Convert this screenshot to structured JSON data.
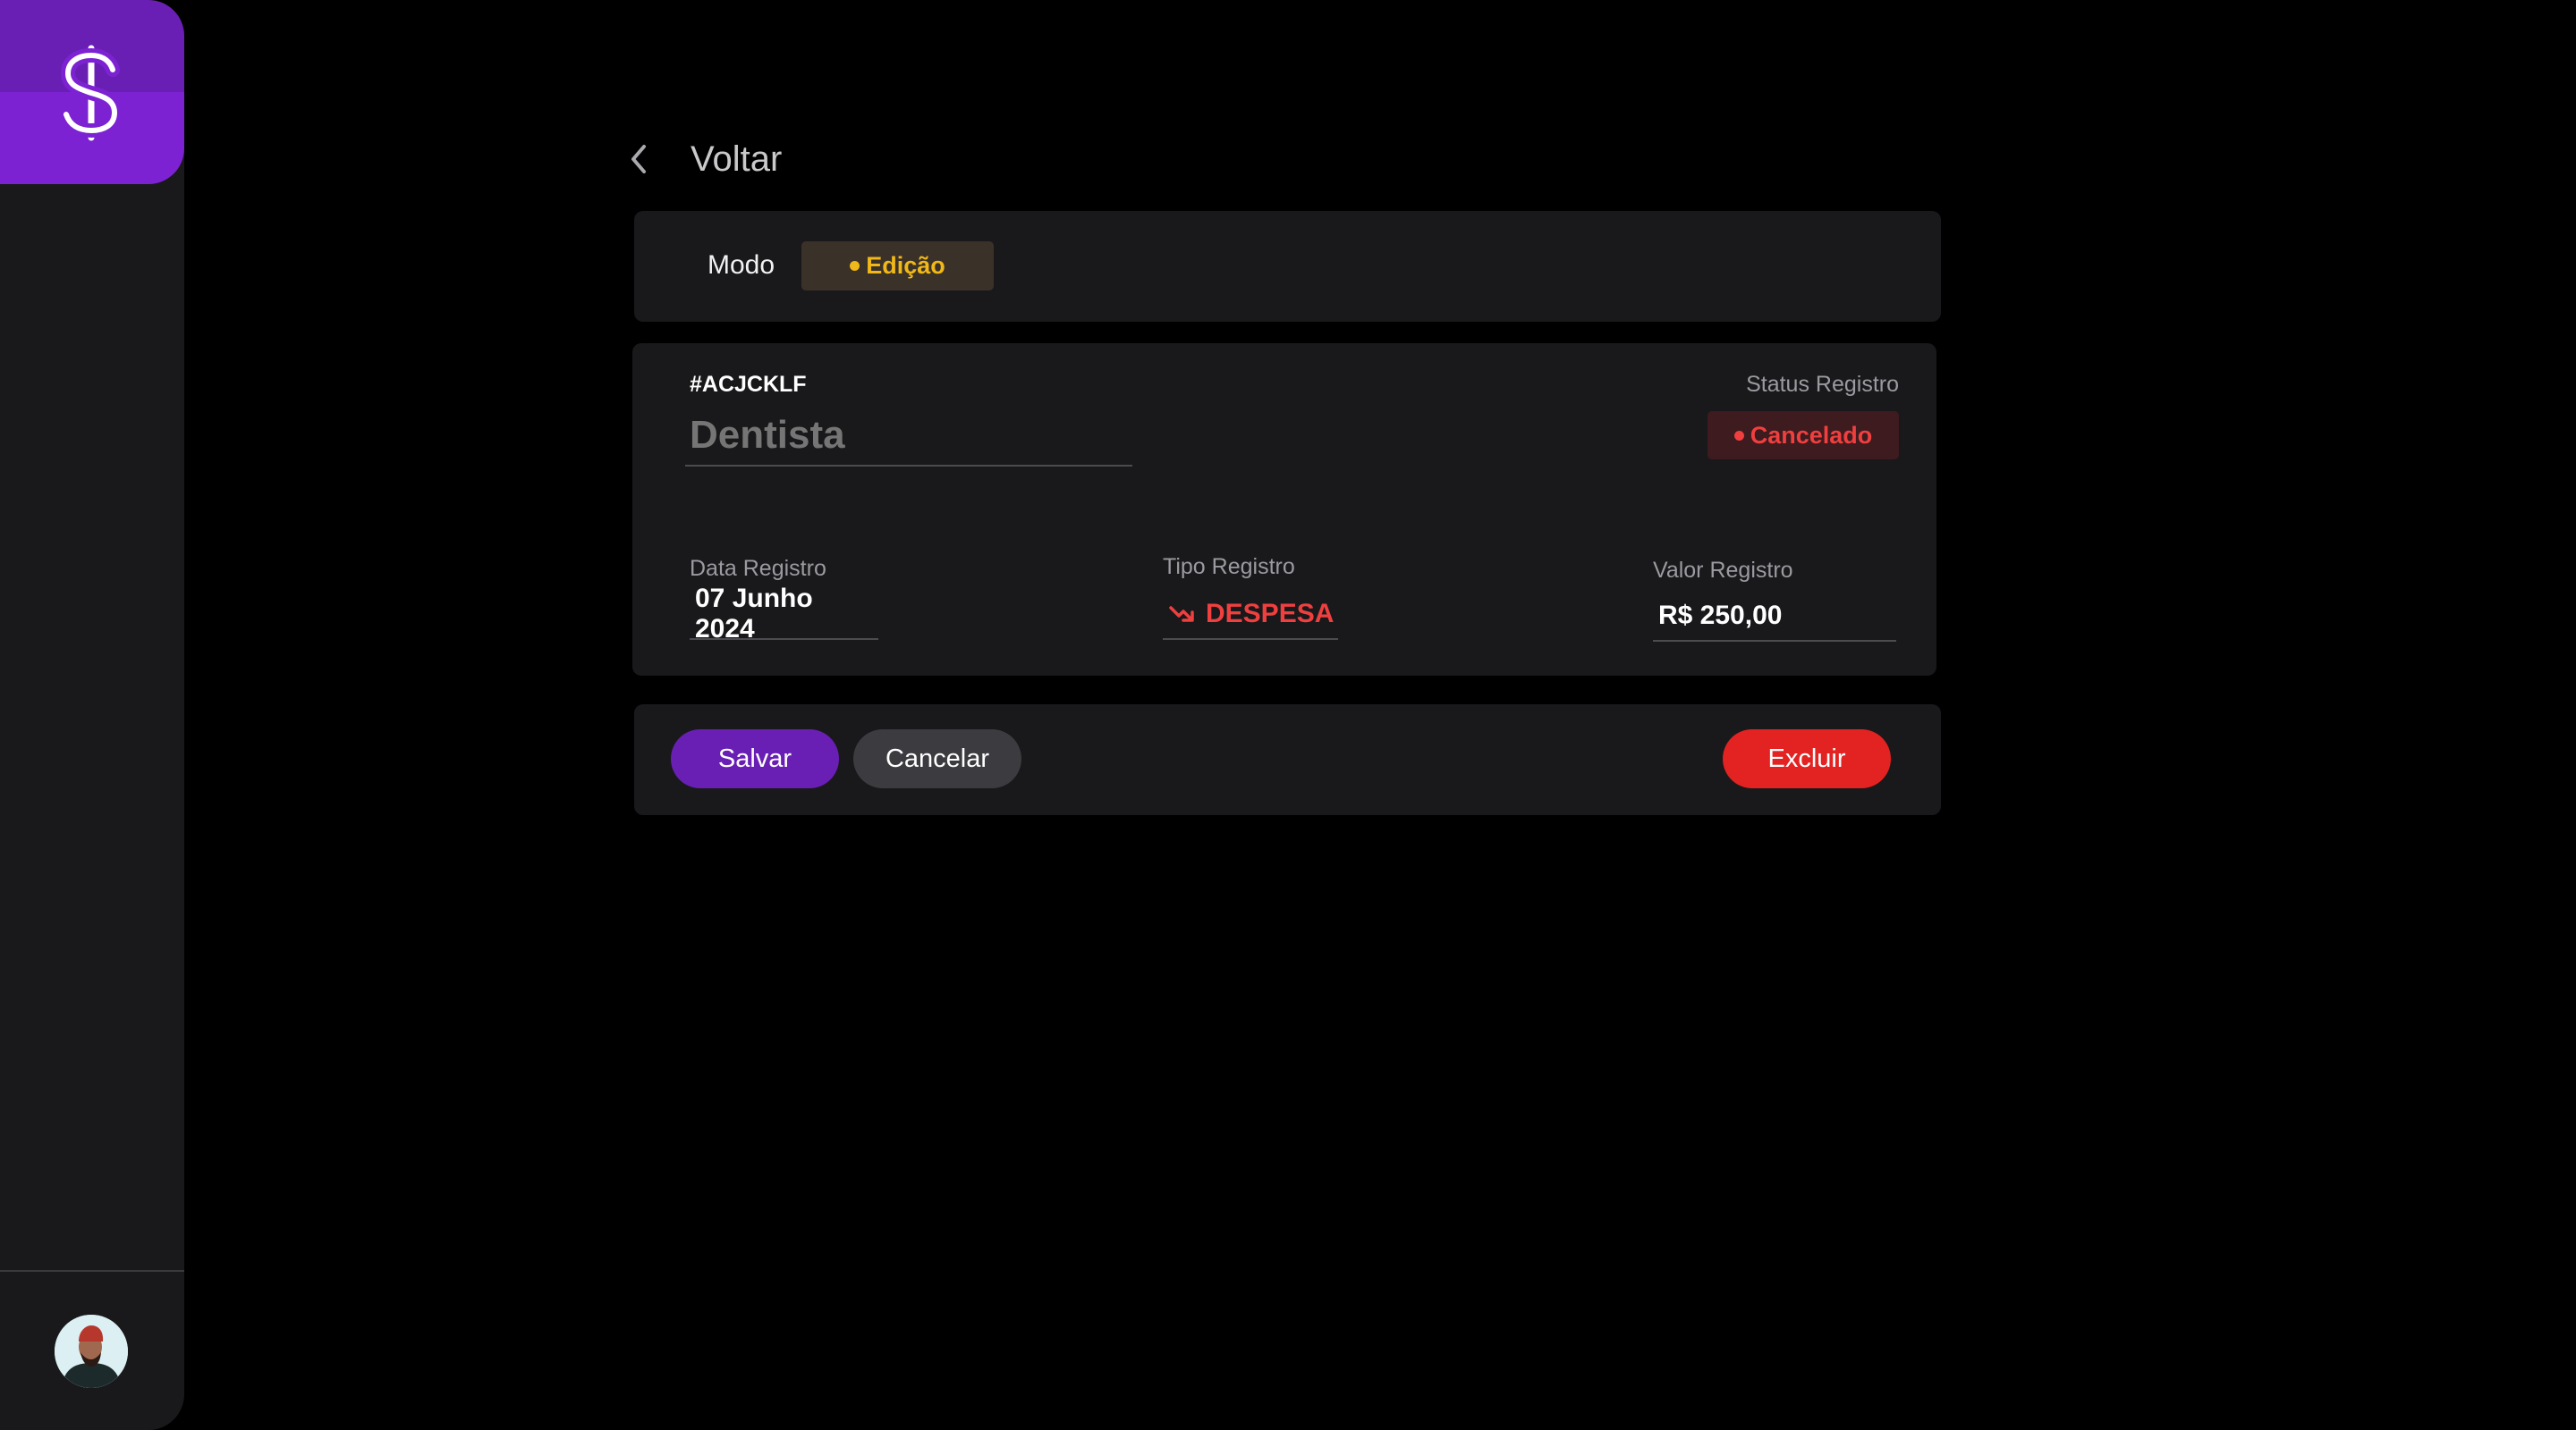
{
  "colors": {
    "background": "#000000",
    "surface": "#19191b",
    "brand": "#7c22d3",
    "warning": "#f0b818",
    "danger": "#ef3f3f"
  },
  "sidebar": {
    "logo_icon": "dollar-sign-icon",
    "avatar": "user-avatar"
  },
  "header": {
    "back_icon": "chevron-left-icon",
    "back_label": "Voltar"
  },
  "mode": {
    "label": "Modo",
    "badge": "Edição"
  },
  "record": {
    "code": "#ACJCKLF",
    "name_placeholder": "Dentista",
    "status_label": "Status Registro",
    "status_value": "Cancelado",
    "date_label": "Data Registro",
    "date_value": "07 Junho 2024",
    "type_label": "Tipo Registro",
    "type_icon": "trending-down-icon",
    "type_value": "DESPESA",
    "amount_label": "Valor Registro",
    "amount_value": "R$ 250,00"
  },
  "actions": {
    "save_label": "Salvar",
    "cancel_label": "Cancelar",
    "delete_label": "Excluir"
  }
}
